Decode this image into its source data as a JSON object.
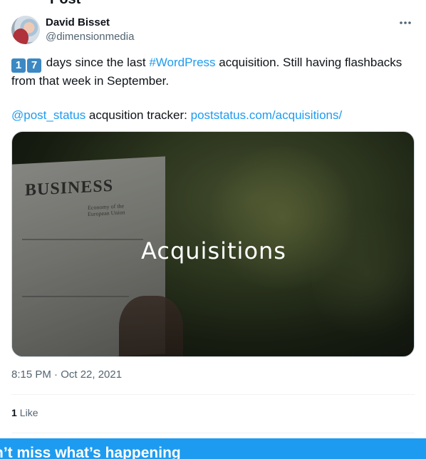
{
  "page": {
    "heading_cut": "Post"
  },
  "author": {
    "name": "David Bisset",
    "handle": "@dimensionmedia"
  },
  "tweet": {
    "keycap_1": "1",
    "keycap_2": "7",
    "line1_pre": " days since the last ",
    "hashtag": "#WordPress",
    "line1_post": " acquisition. Still having flashbacks from that week in September.",
    "mention": "@post_status",
    "tracker_text": " acqusition tracker: ",
    "tracker_link": "poststatus.com/acquisitions/"
  },
  "media": {
    "caption": "Acquisitions",
    "paper_heading": "BUSINESS",
    "paper_sub": "Economy of the European Union"
  },
  "meta": {
    "timestamp": "8:15 PM · Oct 22, 2021",
    "like_count": "1",
    "like_label": "Like"
  },
  "banner": {
    "text": "n’t miss what’s happening"
  },
  "icons": {
    "more": "more-horizontal-icon"
  },
  "colors": {
    "accent": "#1d9bf0",
    "keycap": "#3b88c3",
    "secondary_text": "#536471"
  }
}
